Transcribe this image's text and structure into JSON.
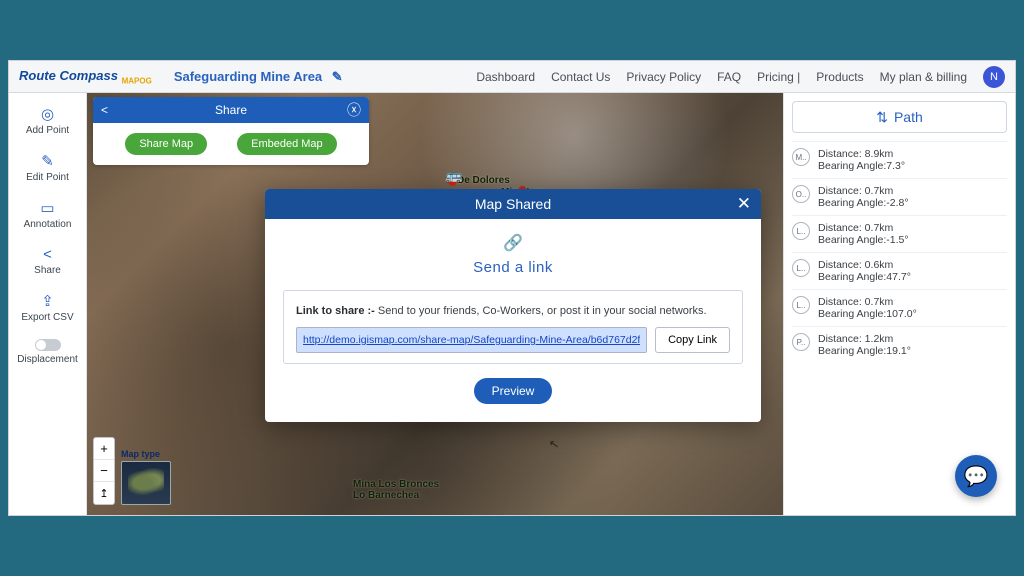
{
  "brand": {
    "name": "Route Compass",
    "sub": "MAPOG"
  },
  "project": {
    "title": "Safeguarding Mine Area"
  },
  "nav": {
    "dashboard": "Dashboard",
    "contact": "Contact Us",
    "privacy": "Privacy Policy",
    "faq": "FAQ",
    "pricing": "Pricing |",
    "products": "Products",
    "plan": "My plan & billing",
    "avatar": "N"
  },
  "sidebar": {
    "addpoint": "Add Point",
    "editpoint": "Edit Point",
    "annotation": "Annotation",
    "share": "Share",
    "export": "Export CSV",
    "displacement": "Displacement"
  },
  "sharebar": {
    "title": "Share",
    "share_map": "Share Map",
    "embed_map": "Embeded Map"
  },
  "map": {
    "type_label": "Map type",
    "label1": "De Dolores",
    "label2": "Estero De Dolores",
    "label3": "Mina Los\nLos Andes",
    "label4": "Mina Los Bronces\nLo Barnechea"
  },
  "modal": {
    "title": "Map Shared",
    "send_link": "Send a link",
    "link_label_b": "Link to share :-",
    "link_label": " Send to your friends, Co-Workers, or post it in your social networks.",
    "url": "http://demo.igismap.com/share-map/Safeguarding-Mine-Area/b6d767d2f",
    "copy": "Copy Link",
    "preview": "Preview"
  },
  "path": {
    "title": "Path",
    "steps": [
      {
        "node": "M..",
        "distance": "Distance: 8.9km",
        "bearing": "Bearing Angle:7.3°"
      },
      {
        "node": "O..",
        "distance": "Distance: 0.7km",
        "bearing": "Bearing Angle:-2.8°"
      },
      {
        "node": "L..",
        "distance": "Distance: 0.7km",
        "bearing": "Bearing Angle:-1.5°"
      },
      {
        "node": "L..",
        "distance": "Distance: 0.6km",
        "bearing": "Bearing Angle:47.7°"
      },
      {
        "node": "L..",
        "distance": "Distance: 0.7km",
        "bearing": "Bearing Angle:107.0°"
      },
      {
        "node": "P..",
        "distance": "Distance: 1.2km",
        "bearing": "Bearing Angle:19.1°"
      }
    ]
  }
}
